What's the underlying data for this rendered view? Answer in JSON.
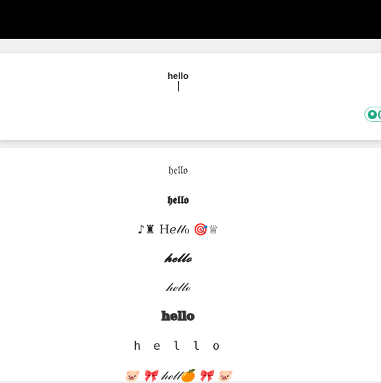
{
  "input": {
    "value": "hello"
  },
  "hint_pill": {
    "icon": "lightbulb-icon",
    "accent": "#1fa885"
  },
  "results": {
    "rows": [
      {
        "text": "𝔥𝔢𝔩𝔩𝔬"
      },
      {
        "text": "𝖍𝖊𝖑𝖑𝖔"
      },
      {
        "text": "♪♜  Hℯ𝓁𝓁ℴ  🎯♕"
      },
      {
        "text": "𝓱𝓮𝓵𝓵𝓸"
      },
      {
        "text": "𝒽ℯ𝓁𝓁ℴ"
      },
      {
        "text": "𝕙𝕖𝕝𝕝𝕠"
      },
      {
        "text": "h e l l o"
      },
      {
        "text": "🐷  🎀  𝒽ℯ𝓁𝓁🍊  🎀  🐷"
      }
    ]
  }
}
